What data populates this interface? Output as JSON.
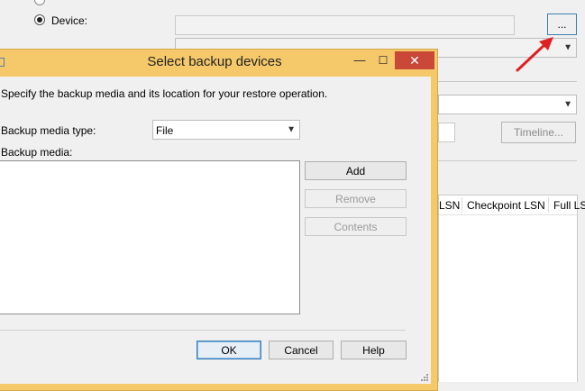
{
  "background": {
    "device_radio_label": "Device:",
    "device_browse_label": "...",
    "timeline_label": "Timeline...",
    "grid_columns": [
      "LSN",
      "Checkpoint LSN",
      "Full LS"
    ]
  },
  "dialog": {
    "title": "Select backup devices",
    "minimize_glyph": "—",
    "maximize_glyph": "☐",
    "close_glyph": "✕",
    "instructions": "Specify the backup media and its location for your restore operation.",
    "media_type_label": "Backup media type:",
    "media_type_value": "File",
    "backup_media_label": "Backup media:",
    "add_label": "Add",
    "remove_label": "Remove",
    "contents_label": "Contents",
    "ok_label": "OK",
    "cancel_label": "Cancel",
    "help_label": "Help"
  },
  "colors": {
    "dialog_frame": "#f5c96a",
    "close_button": "#c94838",
    "arrow": "#e02020"
  }
}
